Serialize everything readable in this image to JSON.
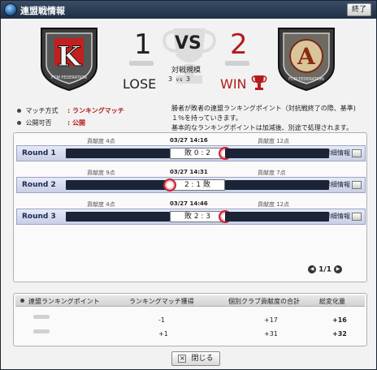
{
  "window": {
    "title": "連盟戦情報",
    "close_label": "終了"
  },
  "scoreboard": {
    "left_score": "1",
    "right_score": "2",
    "vs": "VS",
    "left_result": "LOSE",
    "right_result": "WIN",
    "scale_label": "対戦規模",
    "scale_left": "3",
    "scale_vs": "vs",
    "scale_right": "3",
    "emblem_text_left": "FCM FEDERATION",
    "emblem_text_right": "FCM FEDERATION",
    "emblem_letter_left": "K",
    "emblem_letter_right": "A"
  },
  "info": {
    "match_type_label": "マッチ方式",
    "match_type_value": ": ランキングマッチ",
    "public_label": "公開可否",
    "public_value": ": 公開",
    "description": [
      "勝者が敗者の連盟ランキングポイント（対抗戦終了の際、基準)",
      "１％を持っていきます。",
      "基本的なランキングポイントは加減後、別途で処理されます。"
    ]
  },
  "rounds": [
    {
      "label": "Round 1",
      "time": "03/27 14:16",
      "left_contrib": "貢献度  4点",
      "right_contrib": "貢献度 12点",
      "score": "敗  0 : 2",
      "detail": "詳細情報"
    },
    {
      "label": "Round 2",
      "time": "03/27 14:31",
      "left_contrib": "貢献度  9点",
      "right_contrib": "貢献度  7点",
      "score": "2 : 1  敗",
      "detail": "詳細情報"
    },
    {
      "label": "Round 3",
      "time": "03/27 14:46",
      "left_contrib": "貢献度  4点",
      "right_contrib": "貢献度 12点",
      "score": "敗  2 : 3",
      "detail": "詳細情報"
    }
  ],
  "pager": {
    "text": "1/1"
  },
  "summary": {
    "headers": [
      "連盟ランキングポイント",
      "ランキングマッチ獲得",
      "個別クラブ貢献度の合計",
      "総変化量"
    ],
    "rows": [
      {
        "gain": "-1",
        "contrib": "+17",
        "total": "+16"
      },
      {
        "gain": "+1",
        "contrib": "+31",
        "total": "+32"
      }
    ]
  },
  "footer": {
    "close_label": "閉じる"
  }
}
